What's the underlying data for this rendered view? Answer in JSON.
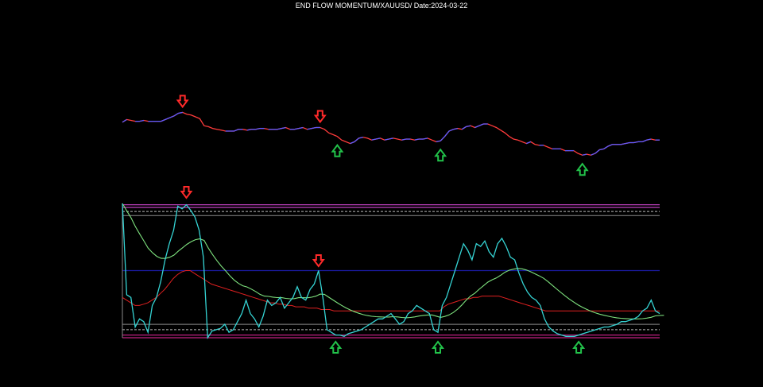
{
  "chart_data": [
    {
      "type": "line",
      "panel": "price",
      "title": "END FLOW MOMENTUM/XAUUSD/ Date:2024-03-22",
      "axes_visible": false,
      "grid": false,
      "colors": {
        "background": "#000000",
        "line_up": "#5b5bff",
        "line_down": "#ff3b3b",
        "sell_arrow": "#ff2a2a",
        "buy_arrow": "#22c24a"
      },
      "series": [
        {
          "values": [
            0.52,
            0.55,
            0.54,
            0.53,
            0.53,
            0.54,
            0.53,
            0.53,
            0.53,
            0.53,
            0.55,
            0.57,
            0.59,
            0.62,
            0.63,
            0.61,
            0.6,
            0.58,
            0.56,
            0.48,
            0.47,
            0.45,
            0.44,
            0.43,
            0.42,
            0.42,
            0.42,
            0.44,
            0.44,
            0.43,
            0.44,
            0.44,
            0.45,
            0.45,
            0.44,
            0.44,
            0.44,
            0.45,
            0.46,
            0.44,
            0.44,
            0.45,
            0.46,
            0.44,
            0.45,
            0.46,
            0.46,
            0.44,
            0.4,
            0.38,
            0.36,
            0.32,
            0.3,
            0.28,
            0.3,
            0.34,
            0.35,
            0.34,
            0.32,
            0.33,
            0.34,
            0.32,
            0.33,
            0.34,
            0.33,
            0.32,
            0.33,
            0.33,
            0.32,
            0.33,
            0.33,
            0.34,
            0.32,
            0.3,
            0.31,
            0.36,
            0.42,
            0.44,
            0.45,
            0.44,
            0.47,
            0.48,
            0.46,
            0.48,
            0.5,
            0.5,
            0.48,
            0.46,
            0.43,
            0.4,
            0.36,
            0.33,
            0.32,
            0.3,
            0.28,
            0.3,
            0.27,
            0.26,
            0.26,
            0.24,
            0.22,
            0.22,
            0.22,
            0.2,
            0.2,
            0.2,
            0.17,
            0.15,
            0.16,
            0.15,
            0.17,
            0.21,
            0.22,
            0.25,
            0.27,
            0.27,
            0.27,
            0.28,
            0.29,
            0.29,
            0.3,
            0.3,
            0.32,
            0.33,
            0.32,
            0.32
          ]
        }
      ],
      "signals": [
        {
          "type": "sell",
          "index": 14
        },
        {
          "type": "sell",
          "index": 46
        },
        {
          "type": "buy",
          "index": 50
        },
        {
          "type": "buy",
          "index": 74
        },
        {
          "type": "buy",
          "index": 107
        }
      ]
    },
    {
      "type": "line",
      "panel": "oscillator",
      "axes_visible": false,
      "grid": false,
      "ylim": [
        0,
        1
      ],
      "colors": {
        "oscillator": "#35d4d4",
        "signal": "#7ee27e",
        "baseline": "#e02020",
        "mid_level": "#1a1aa0",
        "upper_band": "#cc44cc",
        "lower_band": "#c02080",
        "dashed_level": "#bbbbbb"
      },
      "levels": {
        "upper_band": [
          0.99,
          0.97
        ],
        "upper_dashed": 0.94,
        "upper_solid": 0.91,
        "mid": 0.5,
        "lower_solid": 0.1,
        "lower_dashed": 0.06,
        "lower_band": [
          0.02,
          0.0
        ]
      },
      "series": [
        {
          "values": [
            1.0,
            0.32,
            0.3,
            0.08,
            0.14,
            0.12,
            0.04,
            0.24,
            0.3,
            0.42,
            0.58,
            0.7,
            0.8,
            0.98,
            0.96,
            0.99,
            0.95,
            0.9,
            0.8,
            0.6,
            0.0,
            0.05,
            0.06,
            0.07,
            0.1,
            0.04,
            0.06,
            0.12,
            0.18,
            0.28,
            0.18,
            0.14,
            0.08,
            0.16,
            0.28,
            0.24,
            0.26,
            0.3,
            0.22,
            0.26,
            0.3,
            0.38,
            0.3,
            0.28,
            0.36,
            0.4,
            0.5,
            0.3,
            0.06,
            0.04,
            0.02,
            0.02,
            0.01,
            0.03,
            0.04,
            0.05,
            0.06,
            0.08,
            0.1,
            0.12,
            0.14,
            0.14,
            0.16,
            0.18,
            0.14,
            0.1,
            0.12,
            0.18,
            0.2,
            0.24,
            0.22,
            0.2,
            0.18,
            0.06,
            0.04,
            0.24,
            0.3,
            0.4,
            0.5,
            0.6,
            0.7,
            0.65,
            0.58,
            0.7,
            0.68,
            0.72,
            0.64,
            0.6,
            0.7,
            0.74,
            0.68,
            0.6,
            0.58,
            0.48,
            0.4,
            0.34,
            0.3,
            0.28,
            0.24,
            0.14,
            0.08,
            0.05,
            0.03,
            0.02,
            0.01,
            0.01,
            0.01,
            0.02,
            0.03,
            0.04,
            0.05,
            0.06,
            0.07,
            0.08,
            0.08,
            0.09,
            0.1,
            0.12,
            0.12,
            0.13,
            0.14,
            0.16,
            0.2,
            0.22,
            0.28,
            0.2,
            0.18
          ]
        },
        {
          "values": [
            0.14,
            0.4,
            0.5,
            0.58,
            0.6,
            0.35,
            0.3,
            0.31,
            0.32,
            0.34,
            0.37,
            0.4,
            0.44,
            0.47,
            0.49,
            0.5,
            0.5,
            0.5,
            0.5,
            0.5,
            0.5,
            0.5,
            0.5,
            0.5,
            0.5,
            0.5,
            0.5,
            0.5,
            0.5,
            0.5,
            0.5,
            0.5,
            0.5,
            0.5,
            0.5,
            0.5,
            0.5,
            0.5,
            0.5,
            0.5,
            0.5,
            0.5,
            0.5,
            0.5,
            0.5,
            0.5,
            0.5,
            0.5,
            0.5,
            0.5,
            0.5,
            0.5,
            0.5,
            0.5,
            0.5,
            0.5,
            0.5,
            0.5,
            0.5,
            0.5,
            0.5,
            0.5,
            0.5,
            0.5,
            0.5,
            0.5,
            0.5,
            0.5,
            0.5,
            0.5,
            0.5,
            0.5,
            0.5,
            0.5,
            0.5,
            0.5,
            0.5,
            0.5,
            0.5,
            0.5,
            0.5,
            0.5,
            0.5,
            0.5,
            0.5,
            0.5,
            0.5,
            0.5,
            0.5,
            0.5,
            0.5,
            0.5,
            0.5,
            0.5,
            0.5,
            0.5,
            0.5,
            0.5,
            0.5,
            0.5,
            0.5,
            0.5,
            0.5,
            0.5,
            0.5,
            0.5,
            0.5,
            0.5,
            0.5,
            0.5,
            0.5,
            0.5,
            0.5,
            0.5,
            0.5,
            0.5,
            0.5,
            0.5,
            0.5,
            0.5,
            0.5,
            0.5,
            0.5,
            0.5,
            0.5,
            0.5
          ]
        },
        {
          "values": [
            0.3,
            0.28,
            0.26,
            0.24,
            0.24,
            0.25,
            0.26,
            0.28,
            0.3,
            0.33,
            0.36,
            0.4,
            0.44,
            0.47,
            0.49,
            0.5,
            0.5,
            0.48,
            0.46,
            0.44,
            0.42,
            0.4,
            0.39,
            0.38,
            0.37,
            0.36,
            0.35,
            0.34,
            0.33,
            0.32,
            0.31,
            0.3,
            0.29,
            0.28,
            0.27,
            0.26,
            0.26,
            0.25,
            0.25,
            0.24,
            0.24,
            0.23,
            0.23,
            0.23,
            0.22,
            0.22,
            0.22,
            0.21,
            0.21,
            0.21,
            0.2,
            0.2,
            0.2,
            0.2,
            0.2,
            0.2,
            0.2,
            0.2,
            0.2,
            0.2,
            0.2,
            0.2,
            0.2,
            0.2,
            0.2,
            0.2,
            0.2,
            0.2,
            0.2,
            0.2,
            0.2,
            0.2,
            0.2,
            0.2,
            0.2,
            0.2,
            0.23,
            0.25,
            0.26,
            0.27,
            0.28,
            0.29,
            0.29,
            0.3,
            0.3,
            0.31,
            0.31,
            0.31,
            0.31,
            0.31,
            0.3,
            0.29,
            0.28,
            0.27,
            0.26,
            0.25,
            0.24,
            0.23,
            0.22,
            0.21,
            0.2,
            0.2,
            0.2,
            0.2,
            0.2,
            0.2,
            0.2,
            0.2,
            0.2,
            0.2,
            0.2,
            0.2,
            0.2,
            0.2,
            0.2,
            0.2,
            0.2,
            0.2,
            0.2,
            0.2,
            0.2,
            0.2,
            0.2,
            0.2,
            0.2,
            0.2,
            0.2,
            0.2
          ]
        }
      ],
      "signals": [
        {
          "type": "sell",
          "index": 15
        },
        {
          "type": "sell",
          "index": 46
        },
        {
          "type": "buy",
          "index": 50
        },
        {
          "type": "buy",
          "index": 74
        },
        {
          "type": "buy",
          "index": 107
        }
      ]
    }
  ]
}
